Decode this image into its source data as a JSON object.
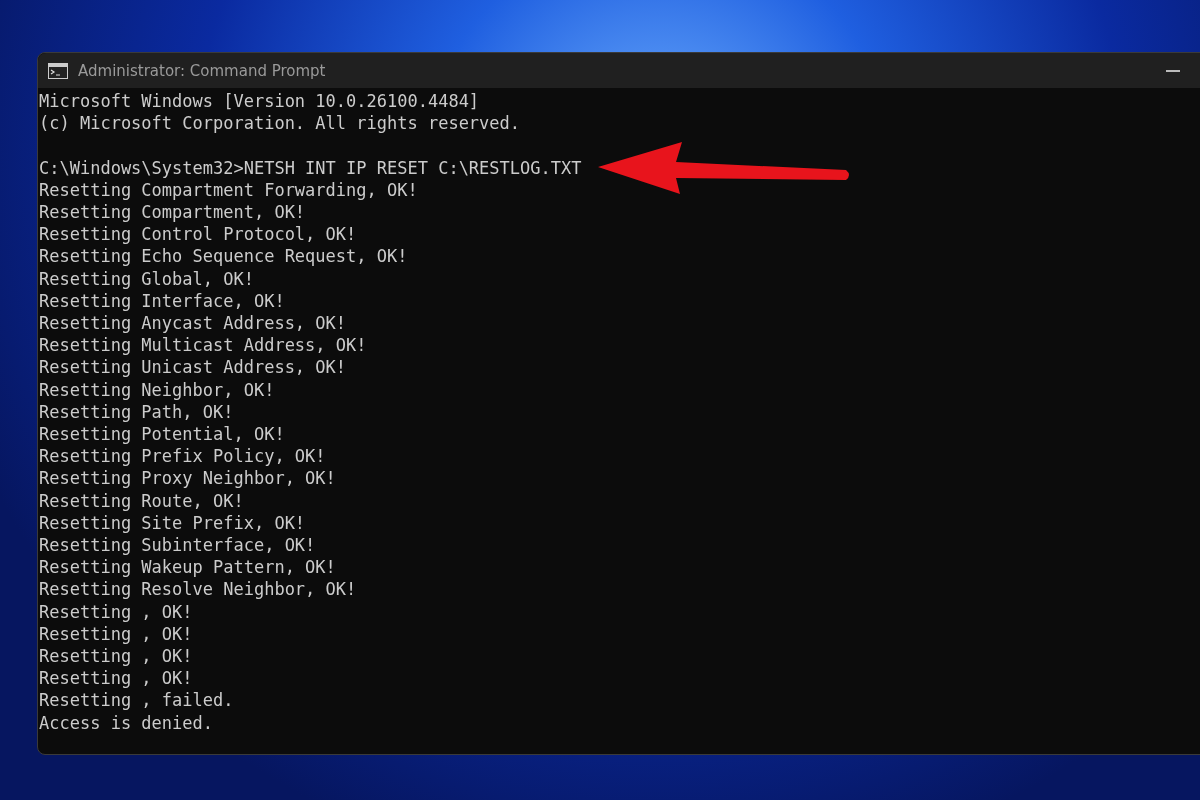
{
  "window": {
    "title": "Administrator: Command Prompt"
  },
  "console": {
    "header": [
      "Microsoft Windows [Version 10.0.26100.4484]",
      "(c) Microsoft Corporation. All rights reserved."
    ],
    "prompt": "C:\\Windows\\System32>",
    "command": "NETSH INT IP RESET C:\\RESTLOG.TXT",
    "output": [
      "Resetting Compartment Forwarding, OK!",
      "Resetting Compartment, OK!",
      "Resetting Control Protocol, OK!",
      "Resetting Echo Sequence Request, OK!",
      "Resetting Global, OK!",
      "Resetting Interface, OK!",
      "Resetting Anycast Address, OK!",
      "Resetting Multicast Address, OK!",
      "Resetting Unicast Address, OK!",
      "Resetting Neighbor, OK!",
      "Resetting Path, OK!",
      "Resetting Potential, OK!",
      "Resetting Prefix Policy, OK!",
      "Resetting Proxy Neighbor, OK!",
      "Resetting Route, OK!",
      "Resetting Site Prefix, OK!",
      "Resetting Subinterface, OK!",
      "Resetting Wakeup Pattern, OK!",
      "Resetting Resolve Neighbor, OK!",
      "Resetting , OK!",
      "Resetting , OK!",
      "Resetting , OK!",
      "Resetting , OK!",
      "Resetting , failed.",
      "Access is denied."
    ]
  }
}
